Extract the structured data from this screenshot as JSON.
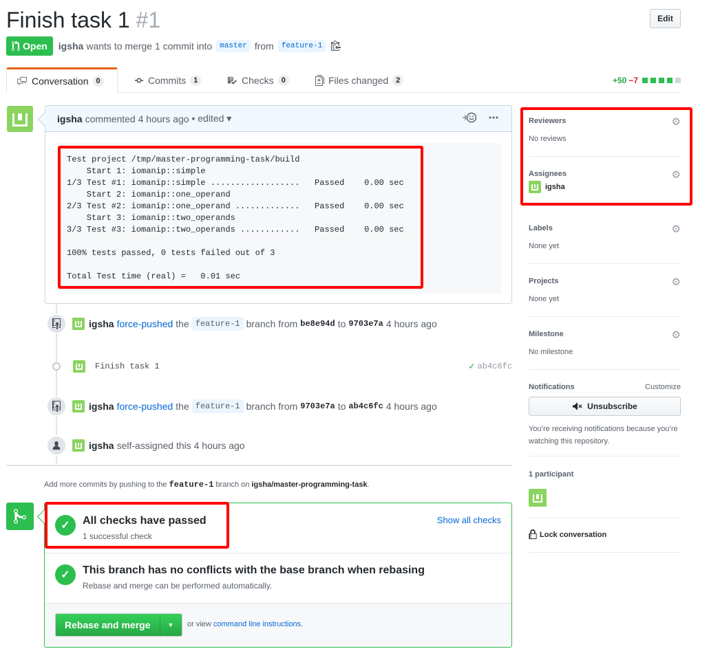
{
  "header": {
    "title": "Finish task 1",
    "number": "#1",
    "edit_label": "Edit",
    "state": "Open",
    "author": "igsha",
    "merge_text_1": "wants to merge 1 commit into",
    "base_branch": "master",
    "from_text": "from",
    "head_branch": "feature-1"
  },
  "tabs": [
    {
      "label": "Conversation",
      "count": "0"
    },
    {
      "label": "Commits",
      "count": "1"
    },
    {
      "label": "Checks",
      "count": "0"
    },
    {
      "label": "Files changed",
      "count": "2"
    }
  ],
  "diffstat": {
    "additions": "+50",
    "deletions": "−7"
  },
  "comment": {
    "author": "igsha",
    "action": "commented 4 hours ago",
    "edited": "• edited ▾",
    "body": "Test project /tmp/master-programming-task/build\n    Start 1: iomanip::simple\n1/3 Test #1: iomanip::simple ..................   Passed    0.00 sec\n    Start 2: iomanip::one_operand\n2/3 Test #2: iomanip::one_operand .............   Passed    0.00 sec\n    Start 3: iomanip::two_operands\n3/3 Test #3: iomanip::two_operands ............   Passed    0.00 sec\n\n100% tests passed, 0 tests failed out of 3\n\nTotal Test time (real) =   0.01 sec"
  },
  "timeline": [
    {
      "author": "igsha",
      "action": "force-pushed",
      "the": "the",
      "branch": "feature-1",
      "branch_from": "branch from",
      "from_sha": "be8e94d",
      "to": "to",
      "to_sha": "9703e7a",
      "time": "4 hours ago"
    },
    {
      "commit_message": "Finish task 1",
      "commit_sha": "ab4c6fc"
    },
    {
      "author": "igsha",
      "action": "force-pushed",
      "the": "the",
      "branch": "feature-1",
      "branch_from": "branch from",
      "from_sha": "9703e7a",
      "to": "to",
      "to_sha": "ab4c6fc",
      "time": "4 hours ago"
    },
    {
      "author": "igsha",
      "action": "self-assigned this 4 hours ago"
    }
  ],
  "hint": {
    "prefix": "Add more commits by pushing to the",
    "branch": "feature-1",
    "middle": "branch on",
    "repo": "igsha/master-programming-task",
    "suffix": "."
  },
  "merge": {
    "checks_title": "All checks have passed",
    "checks_sub": "1 successful check",
    "show_all": "Show all checks",
    "conflict_title": "This branch has no conflicts with the base branch when rebasing",
    "conflict_sub": "Rebase and merge can be performed automatically.",
    "button_label": "Rebase and merge",
    "or_view": "or view",
    "cli_link": "command line instructions",
    "period": "."
  },
  "sidebar": {
    "reviewers": {
      "heading": "Reviewers",
      "value": "No reviews"
    },
    "assignees": {
      "heading": "Assignees",
      "value": "igsha"
    },
    "labels": {
      "heading": "Labels",
      "value": "None yet"
    },
    "projects": {
      "heading": "Projects",
      "value": "None yet"
    },
    "milestone": {
      "heading": "Milestone",
      "value": "No milestone"
    },
    "notifications": {
      "heading": "Notifications",
      "customize": "Customize",
      "button": "Unsubscribe",
      "note": "You’re receiving notifications because you’re watching this repository."
    },
    "participants": {
      "heading": "1 participant"
    },
    "lock": "Lock conversation"
  },
  "colors": {
    "accent_green": "#2cbe4e",
    "link": "#0366d6",
    "highlight_red": "#ff0000",
    "open_badge": "#2cbe4e"
  },
  "icons": [
    "git-pull-request-icon",
    "clipboard-icon",
    "comment-icon",
    "commit-icon",
    "checklist-icon",
    "file-diff-icon",
    "smiley-icon",
    "kebab-icon",
    "repo-push-icon",
    "person-icon",
    "check-icon",
    "git-merge-icon",
    "gear-icon",
    "mute-icon",
    "lock-icon"
  ]
}
